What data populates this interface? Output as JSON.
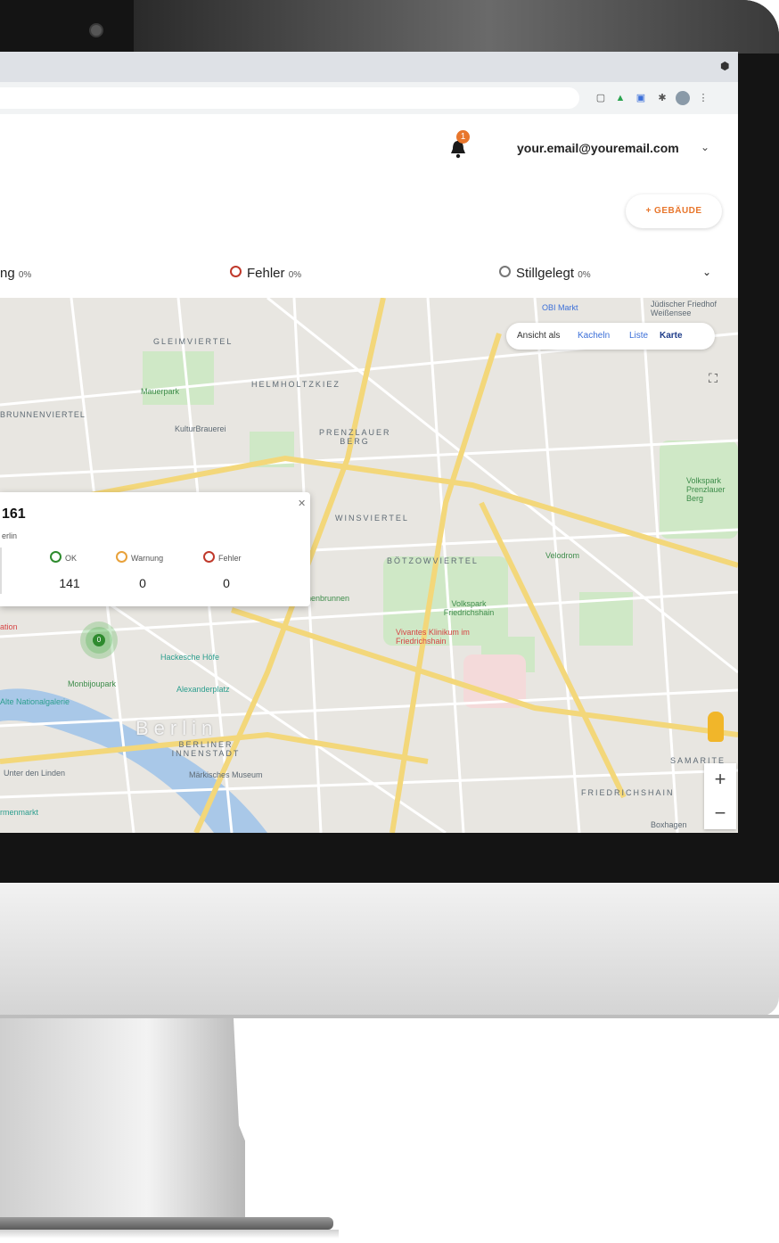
{
  "header": {
    "notification_count": "1",
    "user_email": "your.email@youremail.com"
  },
  "toolbar": {
    "add_building_label": "+ GEBÄUDE"
  },
  "status_filters": [
    {
      "label": "ng",
      "percent": "0%",
      "color": "#e8a13a"
    },
    {
      "label": "Fehler",
      "percent": "0%",
      "color": "#c0392b"
    },
    {
      "label": "Stillgelegt",
      "percent": "0%",
      "color": "#888888"
    }
  ],
  "view_switch": {
    "label": "Ansicht als",
    "options": [
      "Kacheln",
      "Liste",
      "Karte"
    ],
    "active": "Karte"
  },
  "popup": {
    "count": "161",
    "city": "erlin",
    "stats": [
      {
        "label": "OK",
        "value": "141",
        "color": "#2e8b2e"
      },
      {
        "label": "Warnung",
        "value": "0",
        "color": "#e8a13a"
      },
      {
        "label": "Fehler",
        "value": "0",
        "color": "#c0392b"
      }
    ]
  },
  "cluster_label": "0",
  "map_labels": {
    "districts": [
      "GLEIMVIERTEL",
      "HELMHOLTZKIEZ",
      "PRENZLAUER BERG",
      "WINSVIERTEL",
      "BÖTZOWVIERTEL",
      "BRUNNENVIERTEL",
      "BERLINER INNENSTADT",
      "FRIEDRICHSHAIN",
      "SAMARITE",
      "Berlin"
    ],
    "pois": [
      "OBI Markt",
      "Jüdischer Friedhof Weißensee",
      "Mauerpark",
      "KulturBrauerei",
      "Volkspark Prenzlauer Berg",
      "Velodrom",
      "Märchenbrunnen",
      "Volkspark Friedrichshain",
      "Vivantes Klinikum im Friedrichshain",
      "Hackesche Höfe",
      "Alexanderplatz",
      "Monbijoupark",
      "Alte Nationalgalerie",
      "Märkisches Museum",
      "Unter den Linden",
      "Boxhagen",
      "rmenmarkt",
      "ation"
    ]
  },
  "map_controls": {
    "zoom_in": "+",
    "zoom_out": "−"
  }
}
